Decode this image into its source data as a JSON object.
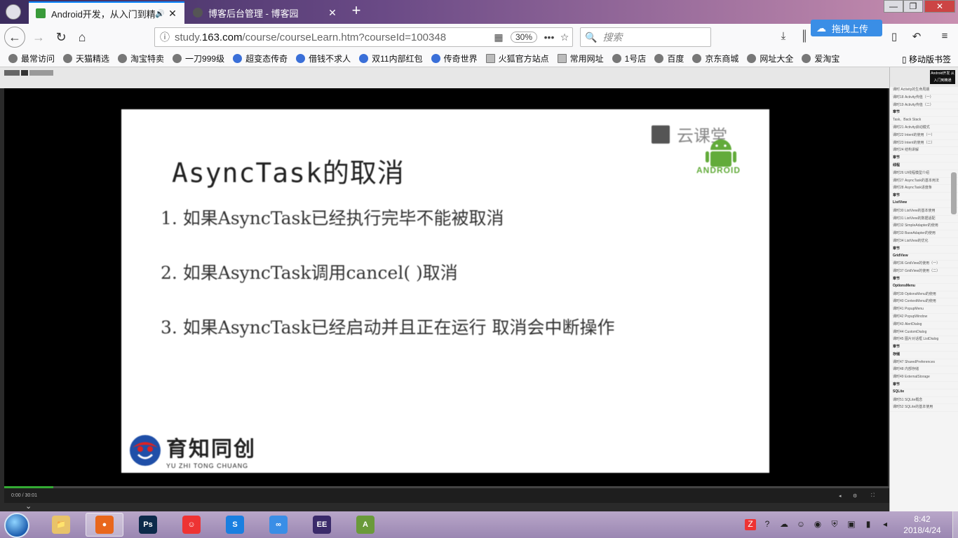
{
  "tabs": [
    {
      "label": "Android开发，从入门到精通",
      "active": true
    },
    {
      "label": "博客后台管理 - 博客园",
      "active": false
    }
  ],
  "window_controls": {
    "minimize": "—",
    "maximize": "❐",
    "close": "✕"
  },
  "navbar": {
    "url_domain": "study.163.com",
    "url_path_before": "study.",
    "url_path_after": "/course/courseLearn.htm?courseId=100348",
    "zoom": "30%",
    "search_placeholder": "搜索",
    "upload_label": "拖拽上传"
  },
  "bookmarks": [
    {
      "label": "最常访问",
      "kind": "globe"
    },
    {
      "label": "天猫精选",
      "kind": "globe"
    },
    {
      "label": "淘宝特卖",
      "kind": "globe"
    },
    {
      "label": "一刀999级",
      "kind": "globe"
    },
    {
      "label": "超变态传奇",
      "kind": "paw"
    },
    {
      "label": "借钱不求人",
      "kind": "paw"
    },
    {
      "label": "双11内部红包",
      "kind": "paw"
    },
    {
      "label": "传奇世界",
      "kind": "paw"
    },
    {
      "label": "火狐官方站点",
      "kind": "folder"
    },
    {
      "label": "常用网址",
      "kind": "folder"
    },
    {
      "label": "1号店",
      "kind": "globe"
    },
    {
      "label": "百度",
      "kind": "globe"
    },
    {
      "label": "京东商城",
      "kind": "globe"
    },
    {
      "label": "网址大全",
      "kind": "globe"
    },
    {
      "label": "爱淘宝",
      "kind": "globe"
    }
  ],
  "mobile_bookmarks": "移动版书签",
  "slide": {
    "title": "AsyncTask的取消",
    "items": [
      "1. 如果AsyncTask已经执行完毕不能被取消",
      "2. 如果AsyncTask调用cancel( )取消",
      "3. 如果AsyncTask已经启动并且正在运行 取消会中断操作"
    ],
    "watermark": "云课堂",
    "android_word": "ANDROID",
    "company_cn": "育知同创",
    "company_en": "YU ZHI TONG CHUANG"
  },
  "player": {
    "time": "0:00 / 30:01"
  },
  "sidebar": {
    "brand": "Android开发 从入门到精通",
    "rows": [
      {
        "text": "课时 Activity的生命周期",
        "hdr": false
      },
      {
        "text": "课时18 Activity传值（一）",
        "hdr": false
      },
      {
        "text": "课时19 Activity传值（二）",
        "hdr": false
      },
      {
        "text": "章节",
        "hdr": true
      },
      {
        "text": "Task、Back Stack",
        "hdr": false
      },
      {
        "text": "课时21 Activity启动模式",
        "hdr": false
      },
      {
        "text": "课时22 Intent的使用（一）",
        "hdr": false
      },
      {
        "text": "课时23 Intent的使用（二）",
        "hdr": false
      },
      {
        "text": "课时24 结构讲解",
        "hdr": false
      },
      {
        "text": "章节",
        "hdr": true
      },
      {
        "text": "线程",
        "hdr": true
      },
      {
        "text": "课时26 UI线程模型介绍",
        "hdr": false
      },
      {
        "text": "课时27 AsyncTask的基本用法",
        "hdr": false
      },
      {
        "text": "课时28 AsyncTask进度条",
        "hdr": false
      },
      {
        "text": "章节",
        "hdr": true
      },
      {
        "text": "ListView",
        "hdr": true
      },
      {
        "text": "课时30 ListView的基本使用",
        "hdr": false
      },
      {
        "text": "课时31 ListView的数据适配",
        "hdr": false
      },
      {
        "text": "课时32 SimpleAdapter的使用",
        "hdr": false
      },
      {
        "text": "课时33 BaseAdapter的使用",
        "hdr": false
      },
      {
        "text": "课时34 ListView的优化",
        "hdr": false
      },
      {
        "text": "章节",
        "hdr": true
      },
      {
        "text": "GridView",
        "hdr": true
      },
      {
        "text": "课时36 GridView的使用（一）",
        "hdr": false
      },
      {
        "text": "课时37 GridView的使用（二）",
        "hdr": false
      },
      {
        "text": "章节",
        "hdr": true
      },
      {
        "text": "OptionsMenu",
        "hdr": true
      },
      {
        "text": "课时39 OptionsMenu的使用",
        "hdr": false
      },
      {
        "text": "课时40 ContextMenu的使用",
        "hdr": false
      },
      {
        "text": "课时41 PopupMenu",
        "hdr": false
      },
      {
        "text": "课时42 PopupWindow",
        "hdr": false
      },
      {
        "text": "课时43 AlertDialog",
        "hdr": false
      },
      {
        "text": "课时44 CustomDialog",
        "hdr": false
      },
      {
        "text": "课时45 图片对话框 ListDialog",
        "hdr": false
      },
      {
        "text": "章节",
        "hdr": true
      },
      {
        "text": "存储",
        "hdr": true
      },
      {
        "text": "课时47 SharedPreferences",
        "hdr": false
      },
      {
        "text": "课时48 内部存储",
        "hdr": false
      },
      {
        "text": "课时49 ExternalStorage",
        "hdr": false
      },
      {
        "text": "章节",
        "hdr": true
      },
      {
        "text": "SQLite",
        "hdr": true
      },
      {
        "text": "课时51 SQLite概念",
        "hdr": false
      },
      {
        "text": "课时52 SQLite的基本使用",
        "hdr": false
      }
    ]
  },
  "taskbar": {
    "apps": [
      {
        "name": "explorer",
        "glyph": "📁",
        "color": "#e8c36a"
      },
      {
        "name": "firefox",
        "glyph": "●",
        "color": "#e8671c"
      },
      {
        "name": "photoshop",
        "glyph": "Ps",
        "color": "#0c2a4a"
      },
      {
        "name": "chat",
        "glyph": "☺",
        "color": "#e33"
      },
      {
        "name": "sogou",
        "glyph": "S",
        "color": "#1a7fe0"
      },
      {
        "name": "baidu-netdisk",
        "glyph": "∞",
        "color": "#3a8ee6"
      },
      {
        "name": "java-ee-ide",
        "glyph": "EE",
        "color": "#3a2a6a"
      },
      {
        "name": "android-studio",
        "glyph": "A",
        "color": "#6a9a3a"
      }
    ],
    "clock_time": "8:42",
    "clock_date": "2018/4/24"
  },
  "colors": {
    "accent": "#0a84ff",
    "android_green": "#62ab3a",
    "upload_blue": "#3a8ee6"
  }
}
